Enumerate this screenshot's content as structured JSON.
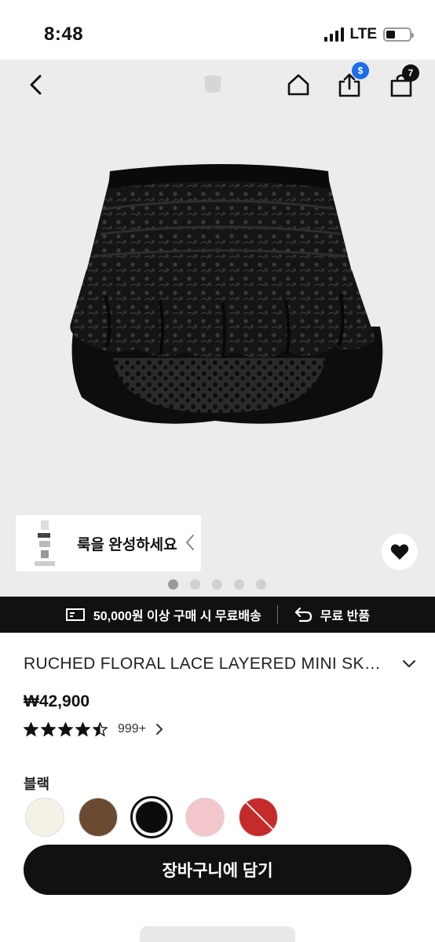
{
  "status_bar": {
    "time": "8:48",
    "network": "LTE",
    "battery_level": 0.4
  },
  "top_nav": {
    "back_icon": "chevron-left-icon",
    "home_icon": "home-icon",
    "share_icon": "share-icon",
    "share_badge": "$",
    "cart_icon": "shopping-bag-icon",
    "cart_count": "7"
  },
  "gallery": {
    "look_card_text": "룩을 완성하세요",
    "image_count": 5,
    "active_index": 0,
    "favorite_icon": "heart-icon"
  },
  "shipping_banner": {
    "free_shipping": "50,000원 이상 구매 시 무료배송",
    "free_return": "무료 반품"
  },
  "product": {
    "title": "RUCHED FLORAL LACE LAYERED MINI SKIRT",
    "price": "₩42,900",
    "rating": 4.5,
    "review_count": "999+",
    "color_label": "블랙",
    "colors": [
      {
        "color": "#f4f1e6"
      },
      {
        "color": "#6b4a32"
      },
      {
        "color": "#0c0c0c",
        "selected": true
      },
      {
        "color": "#f3c6cc"
      },
      {
        "color": "#c62b2b",
        "sold_out": true
      }
    ]
  },
  "cta": {
    "add_to_cart": "장바구니에 담기"
  },
  "colors": {
    "accent": "#111111",
    "share_badge": "#1b6ee8",
    "image_bg": "#ececec"
  }
}
